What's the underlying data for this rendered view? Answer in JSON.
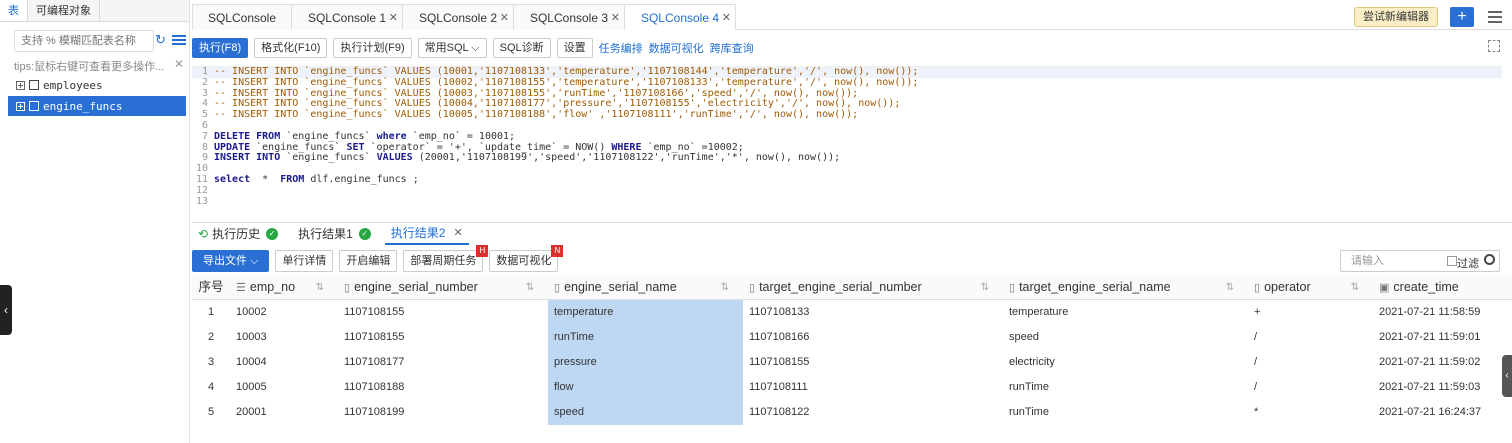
{
  "left": {
    "tabs": [
      "表",
      "可编程对象"
    ],
    "search_placeholder": "支持 % 模糊匹配表名称",
    "tips": "tips:鼠标右键可查看更多操作...",
    "tree": [
      "employees",
      "engine_funcs"
    ]
  },
  "editor_tabs": [
    "SQLConsole",
    "SQLConsole 1",
    "SQLConsole 2",
    "SQLConsole 3",
    "SQLConsole 4"
  ],
  "try_new_editor": "尝试新编辑器",
  "toolbar": {
    "buttons": [
      "执行(F8)",
      "格式化(F10)",
      "执行计划(F9)",
      "常用SQL",
      "SQL诊断",
      "设置"
    ],
    "links": [
      "任务编排",
      "数据可视化",
      "跨库查询"
    ]
  },
  "code_lines": [
    {
      "n": "1",
      "text": "-- INSERT INTO `engine_funcs` VALUES (10001,'1107108133','temperature','1107108144','temperature','/', now(), now());"
    },
    {
      "n": "2",
      "text": "-- INSERT INTO `engine_funcs` VALUES (10002,'1107108155','temperature','1107108133','temperature','/', now(), now());"
    },
    {
      "n": "3",
      "text": "-- INSERT INTO `engine_funcs` VALUES (10003,'1107108155','runTime','1107108166','speed','/', now(), now());"
    },
    {
      "n": "4",
      "text": "-- INSERT INTO `engine_funcs` VALUES (10004,'1107108177','pressure','1107108155','electricity','/', now(), now());"
    },
    {
      "n": "5",
      "text": "-- INSERT INTO `engine_funcs` VALUES (10005,'1107108188','flow' ,'1107108111','runTime','/', now(), now());"
    },
    {
      "n": "6",
      "text": ""
    },
    {
      "n": "7",
      "text": "DELETE FROM `engine_funcs` where `emp_no` = 10001;"
    },
    {
      "n": "8",
      "text": "UPDATE `engine_funcs` SET `operator` = '+', `update_time` = NOW() WHERE `emp_no` =10002;"
    },
    {
      "n": "9",
      "text": "INSERT INTO `engine_funcs` VALUES (20001,'1107108199','speed','1107108122','runTime','*', now(), now());"
    },
    {
      "n": "10",
      "text": ""
    },
    {
      "n": "11",
      "text": "select  *  FROM dlf.engine_funcs ;"
    },
    {
      "n": "12",
      "text": ""
    },
    {
      "n": "13",
      "text": ""
    }
  ],
  "result_tabs": [
    "执行历史",
    "执行结果1",
    "执行结果2"
  ],
  "result_toolbar": {
    "export": "导出文件",
    "buttons": [
      "单行详情",
      "开启编辑",
      "部署周期任务",
      "数据可视化"
    ],
    "badges": [
      "H",
      "N"
    ],
    "search_placeholder": "请输入",
    "filter_label": "过滤"
  },
  "table": {
    "headers": [
      "序号",
      "emp_no",
      "engine_serial_number",
      "engine_serial_name",
      "target_engine_serial_number",
      "target_engine_serial_name",
      "operator",
      "create_time"
    ],
    "rows": [
      [
        "1",
        "10002",
        "1107108155",
        "temperature",
        "1107108133",
        "temperature",
        "+",
        "2021-07-21 11:58:59"
      ],
      [
        "2",
        "10003",
        "1107108155",
        "runTime",
        "1107108166",
        "speed",
        "/",
        "2021-07-21 11:59:01"
      ],
      [
        "3",
        "10004",
        "1107108177",
        "pressure",
        "1107108155",
        "electricity",
        "/",
        "2021-07-21 11:59:02"
      ],
      [
        "4",
        "10005",
        "1107108188",
        "flow",
        "1107108111",
        "runTime",
        "/",
        "2021-07-21 11:59:03"
      ],
      [
        "5",
        "20001",
        "1107108199",
        "speed",
        "1107108122",
        "runTime",
        "*",
        "2021-07-21 16:24:37"
      ]
    ]
  },
  "colors": {
    "primary": "#2a6fd3",
    "highlight_col": "#bed8f4",
    "comment": "#a05a00",
    "keyword": "#1a1a8c"
  }
}
